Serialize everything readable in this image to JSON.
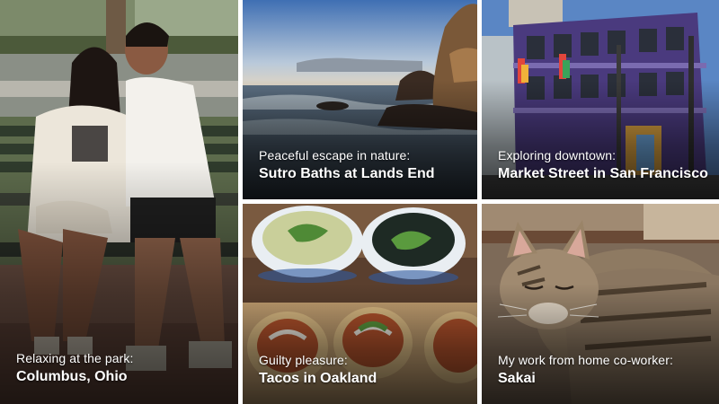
{
  "tiles": [
    {
      "kicker": "Relaxing at the park:",
      "headline": "Columbus, Ohio"
    },
    {
      "kicker": "Peaceful escape in nature:",
      "headline": "Sutro Baths at Lands End"
    },
    {
      "kicker": "Exploring downtown:",
      "headline": "Market Street in San Francisco"
    },
    {
      "kicker": "Guilty pleasure:",
      "headline": "Tacos in Oakland"
    },
    {
      "kicker": "My work from home co-worker:",
      "headline": "Sakai"
    }
  ],
  "colors": {
    "caption_text": "#ffffff",
    "gutter": "#ffffff"
  }
}
